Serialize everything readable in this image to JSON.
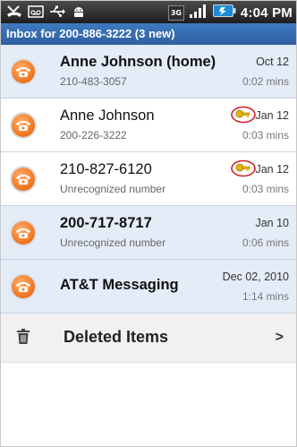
{
  "status_bar": {
    "time": "4:04 PM",
    "network_badge": "3G",
    "icons": [
      "missed-call-icon",
      "voicemail-icon",
      "usb-icon",
      "android-icon",
      "network-3g-icon",
      "signal-icon",
      "battery-icon"
    ]
  },
  "inbox": {
    "title": "Inbox for 200-886-3222 (3 new)"
  },
  "messages": [
    {
      "name": "Anne Johnson (home)",
      "detail": "210-483-3057",
      "date": "Oct 12",
      "duration": "0:02 mins",
      "unread": true,
      "key": false
    },
    {
      "name": "Anne Johnson",
      "detail": "200-226-3222",
      "date": "Jan 12",
      "duration": "0:03 mins",
      "unread": false,
      "key": true
    },
    {
      "name": "210-827-6120",
      "detail": "Unrecognized number",
      "date": "Jan 12",
      "duration": "0:03 mins",
      "unread": false,
      "key": true
    },
    {
      "name": "200-717-8717",
      "detail": "Unrecognized number",
      "date": "Jan 10",
      "duration": "0:06 mins",
      "unread": true,
      "key": false
    },
    {
      "name": "AT&T Messaging",
      "detail": "",
      "date": "Dec 02, 2010",
      "duration": "1:14 mins",
      "unread": true,
      "key": false
    }
  ],
  "deleted": {
    "label": "Deleted Items",
    "chevron": ">"
  },
  "colors": {
    "header_blue": "#3a70b4",
    "unread_bg": "#e4ecf8",
    "phone_orange": "#f47f2a",
    "key_gold": "#e8b400",
    "circle_red": "#d0202a"
  }
}
